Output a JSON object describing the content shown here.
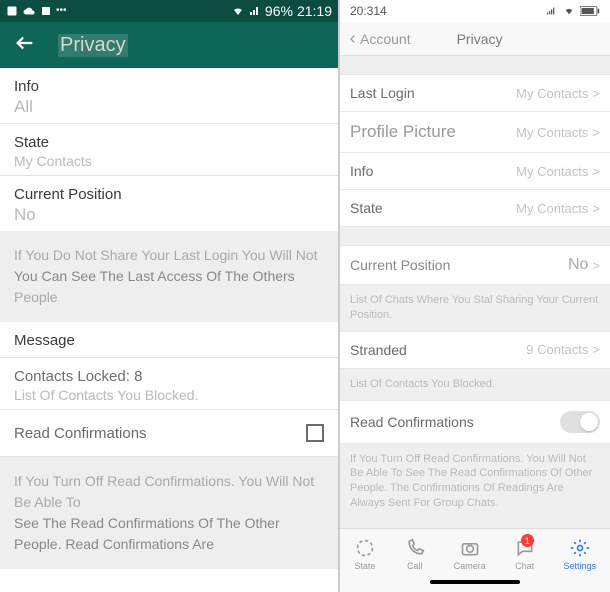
{
  "left": {
    "status": {
      "percent": "96%",
      "time": "21:19"
    },
    "header": {
      "title": "Privacy"
    },
    "info": {
      "label": "Info",
      "value": "All"
    },
    "state": {
      "label": "State",
      "value": "My Contacts"
    },
    "currentPosition": {
      "label": "Current Position",
      "value": "No"
    },
    "lastLoginNote": {
      "line1": "If You Do Not Share Your Last Login You Will Not",
      "line2": "You Can See The Last Access Of The Others",
      "line3": "People"
    },
    "message": {
      "label": "Message"
    },
    "contactsLocked": {
      "label": "Contacts Locked: 8",
      "note": "List Of Contacts You Blocked."
    },
    "readConfirm": {
      "label": "Read Confirmations"
    },
    "readNote": {
      "line1": "If You Turn Off Read Confirmations. You Will Not Be Able To",
      "line2": "See The Read Confirmations Of The Other",
      "line3": "People. Read Confirmations Are"
    }
  },
  "right": {
    "status": {
      "time": "20:314"
    },
    "nav": {
      "back": "Account",
      "title": "Privacy"
    },
    "lastLogin": {
      "label": "Last Login",
      "value": "My Contacts"
    },
    "profilePicture": {
      "label": "Profile Picture",
      "value": "My Contacts"
    },
    "info": {
      "label": "Info",
      "value": "My Contacts"
    },
    "state": {
      "label": "State",
      "value": "My Contacts"
    },
    "currentPosition": {
      "label": "Current Position",
      "value": "No"
    },
    "positionNote": "List Of Chats Where You Stal Sharing Your Current Position.",
    "stranded": {
      "label": "Stranded",
      "value": "9 Contacts"
    },
    "blockedNote": "List Of Contacts You Blocked.",
    "readConfirm": {
      "label": "Read Confirmations"
    },
    "readNote": "If You Turn Off Read Confirmations. You Will Not Be Able To See The Read Confirmations Of Other People. The Confirmations Of Readings Are Always Sent For Group Chats.",
    "tabs": {
      "state": "State",
      "call": "Call",
      "camera": "Camera",
      "chat": "Chat",
      "chatBadge": "1",
      "settings": "Settings"
    }
  }
}
